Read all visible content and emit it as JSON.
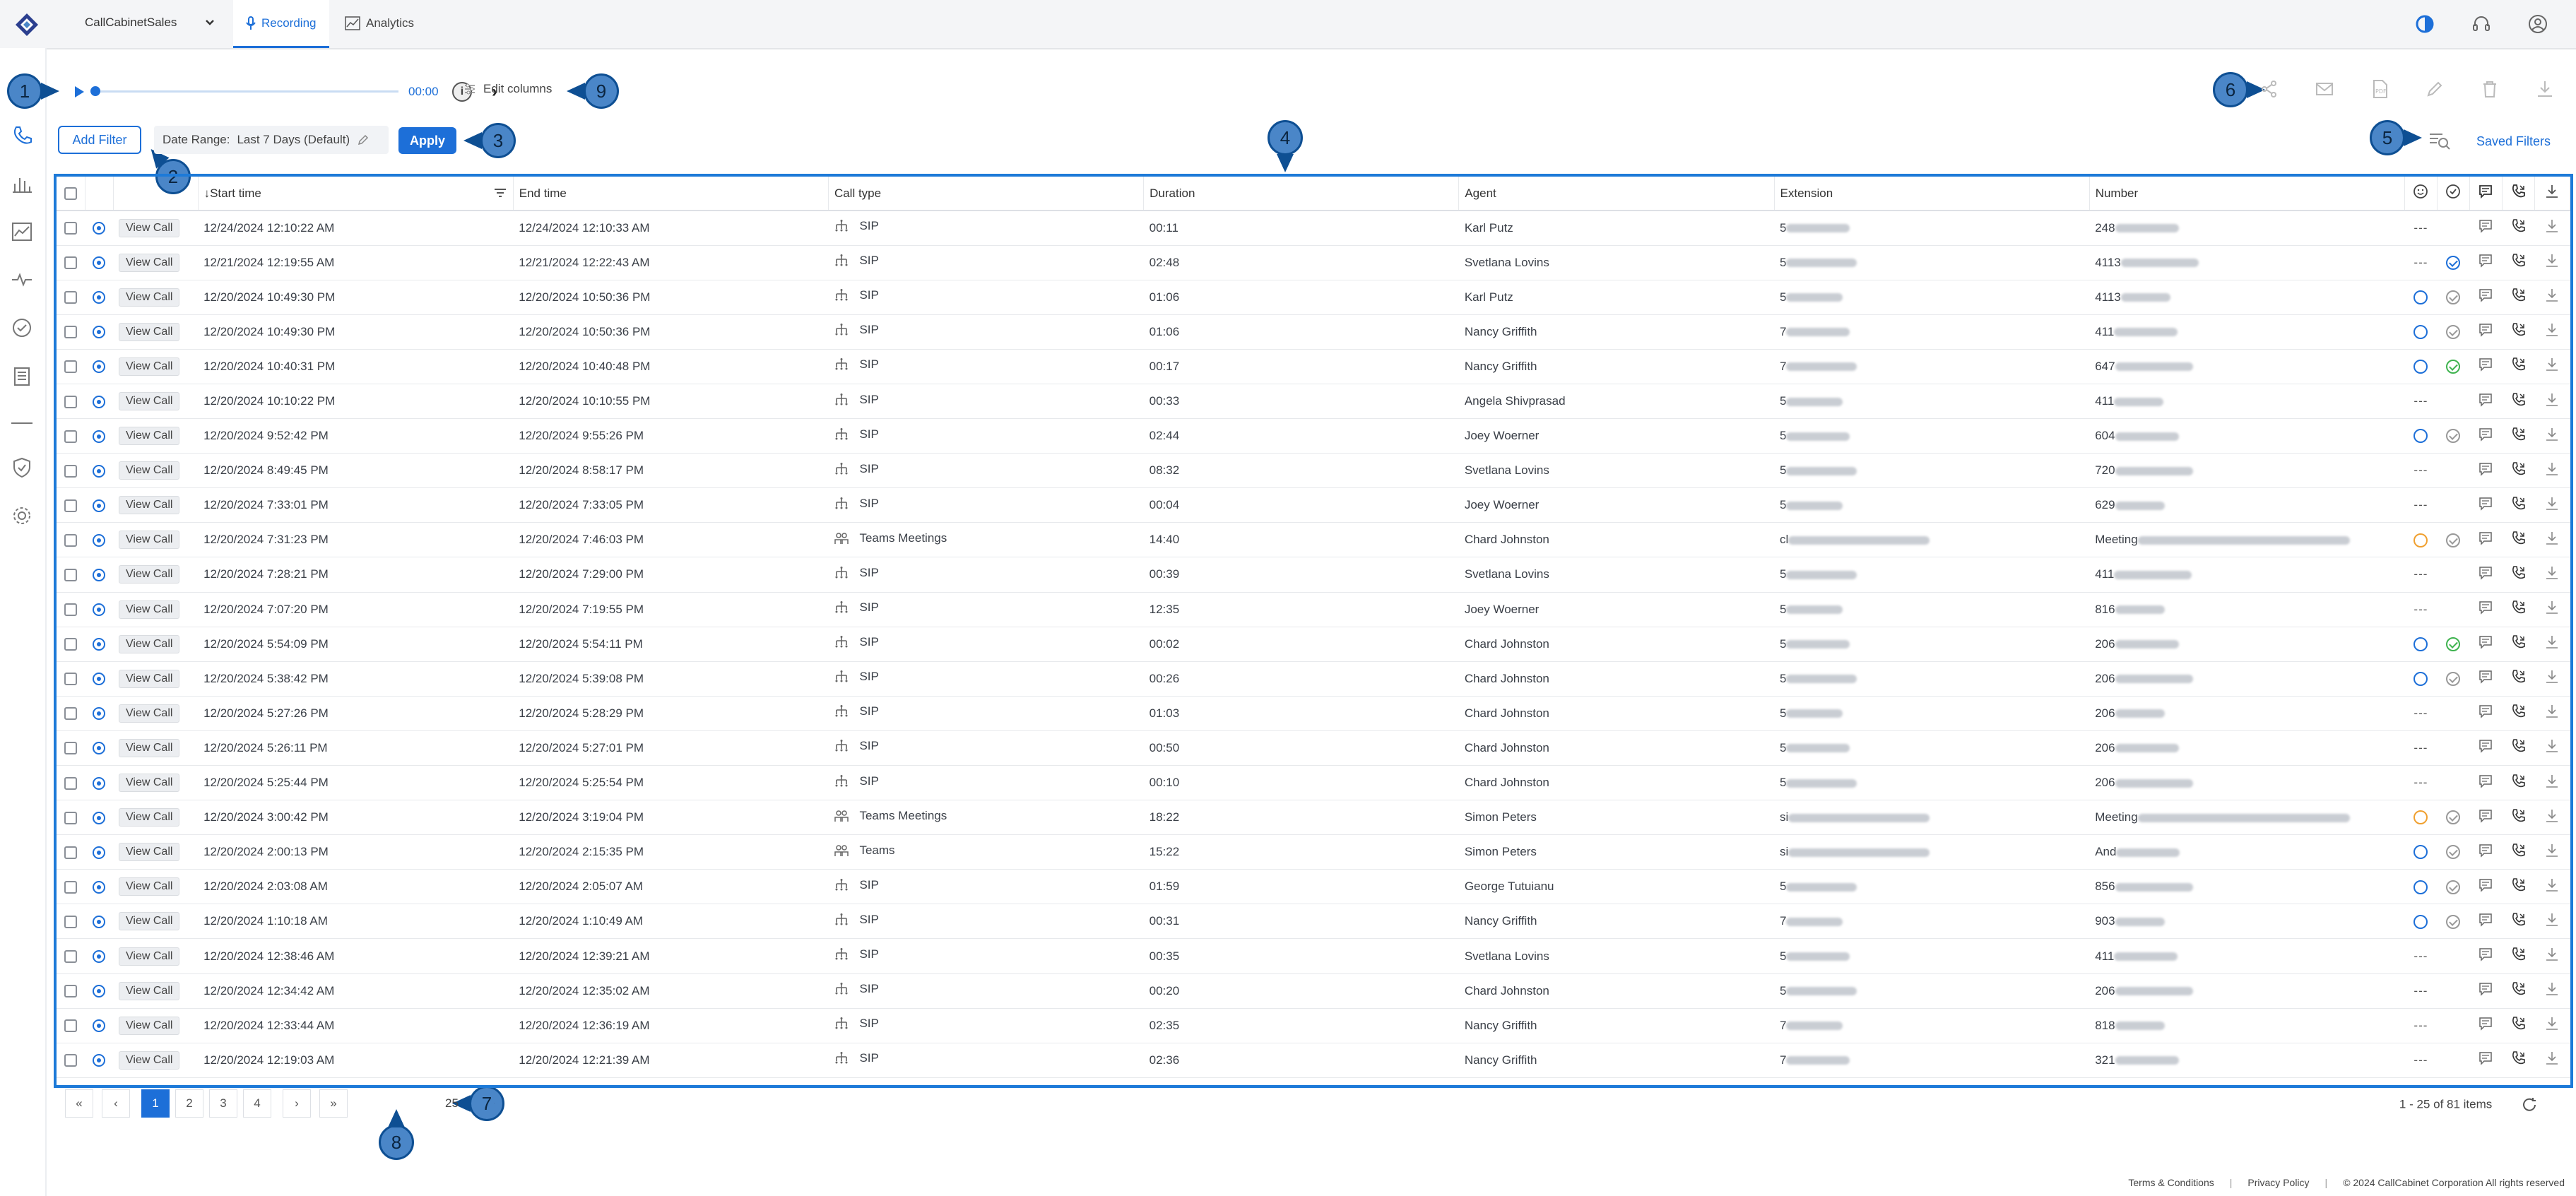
{
  "topnav": {
    "app_name": "CallCabinetSales",
    "tabs": [
      {
        "label": "Recording",
        "active": true
      },
      {
        "label": "Analytics",
        "active": false
      }
    ],
    "icons": [
      "theme-icon",
      "headset-icon",
      "user-icon"
    ]
  },
  "sidebar": {
    "icons": [
      "phone-icon",
      "bar-chart-icon",
      "line-chart-icon",
      "pulse-icon",
      "check-circle-icon",
      "clipboard-icon",
      "shield-icon",
      "settings-icon"
    ]
  },
  "player": {
    "time": "00:00"
  },
  "toolbar": {
    "edit_columns_label": "Edit columns",
    "actions": [
      "share-icon",
      "email-icon",
      "pdf-icon",
      "edit-icon",
      "delete-icon",
      "download-icon"
    ]
  },
  "filters": {
    "add_filter_label": "Add Filter",
    "date_range_label": "Date Range:",
    "date_range_value": "Last 7 Days (Default)",
    "apply_label": "Apply",
    "saved_filters_label": "Saved Filters"
  },
  "callouts": [
    "1",
    "2",
    "3",
    "4",
    "5",
    "6",
    "7",
    "8",
    "9"
  ],
  "table": {
    "columns": [
      "Start time",
      "End time",
      "Call type",
      "Duration",
      "Agent",
      "Extension",
      "Number"
    ],
    "view_call_label": "View Call",
    "rows": [
      {
        "start": "12/24/2024 12:10:22 AM",
        "end": "12/24/2024 12:10:33 AM",
        "type": "SIP",
        "duration": "00:11",
        "agent": "Karl Putz",
        "ext": "5",
        "num": "248",
        "sent": "dash",
        "qa": "",
        "flag": ""
      },
      {
        "start": "12/21/2024 12:19:55 AM",
        "end": "12/21/2024 12:22:43 AM",
        "type": "SIP",
        "duration": "02:48",
        "agent": "Svetlana Lovins",
        "ext": "5",
        "num": "4113",
        "sent": "dash",
        "qa": "blue"
      },
      {
        "start": "12/20/2024 10:49:30 PM",
        "end": "12/20/2024 10:50:36 PM",
        "type": "SIP",
        "duration": "01:06",
        "agent": "Karl Putz",
        "ext": "5",
        "num": "4113",
        "sent": "blue",
        "qa": "grey"
      },
      {
        "start": "12/20/2024 10:49:30 PM",
        "end": "12/20/2024 10:50:36 PM",
        "type": "SIP",
        "duration": "01:06",
        "agent": "Nancy Griffith",
        "ext": "7",
        "num": "411",
        "sent": "blue",
        "qa": "grey"
      },
      {
        "start": "12/20/2024 10:40:31 PM",
        "end": "12/20/2024 10:40:48 PM",
        "type": "SIP",
        "duration": "00:17",
        "agent": "Nancy Griffith",
        "ext": "7",
        "num": "647",
        "sent": "blue",
        "qa": "green"
      },
      {
        "start": "12/20/2024 10:10:22 PM",
        "end": "12/20/2024 10:10:55 PM",
        "type": "SIP",
        "duration": "00:33",
        "agent": "Angela Shivprasad",
        "ext": "5",
        "num": "411",
        "sent": "dash",
        "qa": ""
      },
      {
        "start": "12/20/2024 9:52:42 PM",
        "end": "12/20/2024 9:55:26 PM",
        "type": "SIP",
        "duration": "02:44",
        "agent": "Joey Woerner",
        "ext": "5",
        "num": "604",
        "sent": "blue",
        "qa": "grey"
      },
      {
        "start": "12/20/2024 8:49:45 PM",
        "end": "12/20/2024 8:58:17 PM",
        "type": "SIP",
        "duration": "08:32",
        "agent": "Svetlana Lovins",
        "ext": "5",
        "num": "720",
        "sent": "dash",
        "qa": ""
      },
      {
        "start": "12/20/2024 7:33:01 PM",
        "end": "12/20/2024 7:33:05 PM",
        "type": "SIP",
        "duration": "00:04",
        "agent": "Joey Woerner",
        "ext": "5",
        "num": "629",
        "sent": "dash",
        "qa": ""
      },
      {
        "start": "12/20/2024 7:31:23 PM",
        "end": "12/20/2024 7:46:03 PM",
        "type": "Teams Meetings",
        "duration": "14:40",
        "agent": "Chard Johnston",
        "ext": "cl",
        "num": "Meeting",
        "sent": "orange",
        "qa": "grey"
      },
      {
        "start": "12/20/2024 7:28:21 PM",
        "end": "12/20/2024 7:29:00 PM",
        "type": "SIP",
        "duration": "00:39",
        "agent": "Svetlana Lovins",
        "ext": "5",
        "num": "411",
        "sent": "dash",
        "qa": ""
      },
      {
        "start": "12/20/2024 7:07:20 PM",
        "end": "12/20/2024 7:19:55 PM",
        "type": "SIP",
        "duration": "12:35",
        "agent": "Joey Woerner",
        "ext": "5",
        "num": "816",
        "sent": "dash",
        "qa": ""
      },
      {
        "start": "12/20/2024 5:54:09 PM",
        "end": "12/20/2024 5:54:11 PM",
        "type": "SIP",
        "duration": "00:02",
        "agent": "Chard Johnston",
        "ext": "5",
        "num": "206",
        "sent": "blue",
        "qa": "green"
      },
      {
        "start": "12/20/2024 5:38:42 PM",
        "end": "12/20/2024 5:39:08 PM",
        "type": "SIP",
        "duration": "00:26",
        "agent": "Chard Johnston",
        "ext": "5",
        "num": "206",
        "sent": "blue",
        "qa": "grey"
      },
      {
        "start": "12/20/2024 5:27:26 PM",
        "end": "12/20/2024 5:28:29 PM",
        "type": "SIP",
        "duration": "01:03",
        "agent": "Chard Johnston",
        "ext": "5",
        "num": "206",
        "sent": "dash",
        "qa": ""
      },
      {
        "start": "12/20/2024 5:26:11 PM",
        "end": "12/20/2024 5:27:01 PM",
        "type": "SIP",
        "duration": "00:50",
        "agent": "Chard Johnston",
        "ext": "5",
        "num": "206",
        "sent": "dash",
        "qa": ""
      },
      {
        "start": "12/20/2024 5:25:44 PM",
        "end": "12/20/2024 5:25:54 PM",
        "type": "SIP",
        "duration": "00:10",
        "agent": "Chard Johnston",
        "ext": "5",
        "num": "206",
        "sent": "dash",
        "qa": ""
      },
      {
        "start": "12/20/2024 3:00:42 PM",
        "end": "12/20/2024 3:19:04 PM",
        "type": "Teams Meetings",
        "duration": "18:22",
        "agent": "Simon Peters",
        "ext": "si",
        "num": "Meeting",
        "sent": "orange",
        "qa": "grey"
      },
      {
        "start": "12/20/2024 2:00:13 PM",
        "end": "12/20/2024 2:15:35 PM",
        "type": "Teams",
        "duration": "15:22",
        "agent": "Simon Peters",
        "ext": "si",
        "num": "And",
        "sent": "blue",
        "qa": "grey"
      },
      {
        "start": "12/20/2024 2:03:08 AM",
        "end": "12/20/2024 2:05:07 AM",
        "type": "SIP",
        "duration": "01:59",
        "agent": "George Tutuianu",
        "ext": "5",
        "num": "856",
        "sent": "blue",
        "qa": "grey"
      },
      {
        "start": "12/20/2024 1:10:18 AM",
        "end": "12/20/2024 1:10:49 AM",
        "type": "SIP",
        "duration": "00:31",
        "agent": "Nancy Griffith",
        "ext": "7",
        "num": "903",
        "sent": "blue",
        "qa": "grey"
      },
      {
        "start": "12/20/2024 12:38:46 AM",
        "end": "12/20/2024 12:39:21 AM",
        "type": "SIP",
        "duration": "00:35",
        "agent": "Svetlana Lovins",
        "ext": "5",
        "num": "411",
        "sent": "dash",
        "qa": ""
      },
      {
        "start": "12/20/2024 12:34:42 AM",
        "end": "12/20/2024 12:35:02 AM",
        "type": "SIP",
        "duration": "00:20",
        "agent": "Chard Johnston",
        "ext": "5",
        "num": "206",
        "sent": "dash",
        "qa": ""
      },
      {
        "start": "12/20/2024 12:33:44 AM",
        "end": "12/20/2024 12:36:19 AM",
        "type": "SIP",
        "duration": "02:35",
        "agent": "Nancy Griffith",
        "ext": "7",
        "num": "818",
        "sent": "dash",
        "qa": ""
      },
      {
        "start": "12/20/2024 12:19:03 AM",
        "end": "12/20/2024 12:21:39 AM",
        "type": "SIP",
        "duration": "02:36",
        "agent": "Nancy Griffith",
        "ext": "7",
        "num": "321",
        "sent": "dash",
        "qa": ""
      }
    ]
  },
  "pagination": {
    "pages": [
      "1",
      "2",
      "3",
      "4"
    ],
    "active_page": "1",
    "page_size": "25",
    "items_text": "1 - 25 of 81 items"
  },
  "footer": {
    "terms": "Terms & Conditions",
    "privacy": "Privacy Policy",
    "copyright": "© 2024 CallCabinet Corporation All rights reserved"
  },
  "colors": {
    "accent": "#1d6fd8",
    "callout_fill": "#4a86c8",
    "callout_border": "#0e4f93",
    "qa_green": "#3fb34f",
    "sentiment_orange": "#f0a030"
  }
}
